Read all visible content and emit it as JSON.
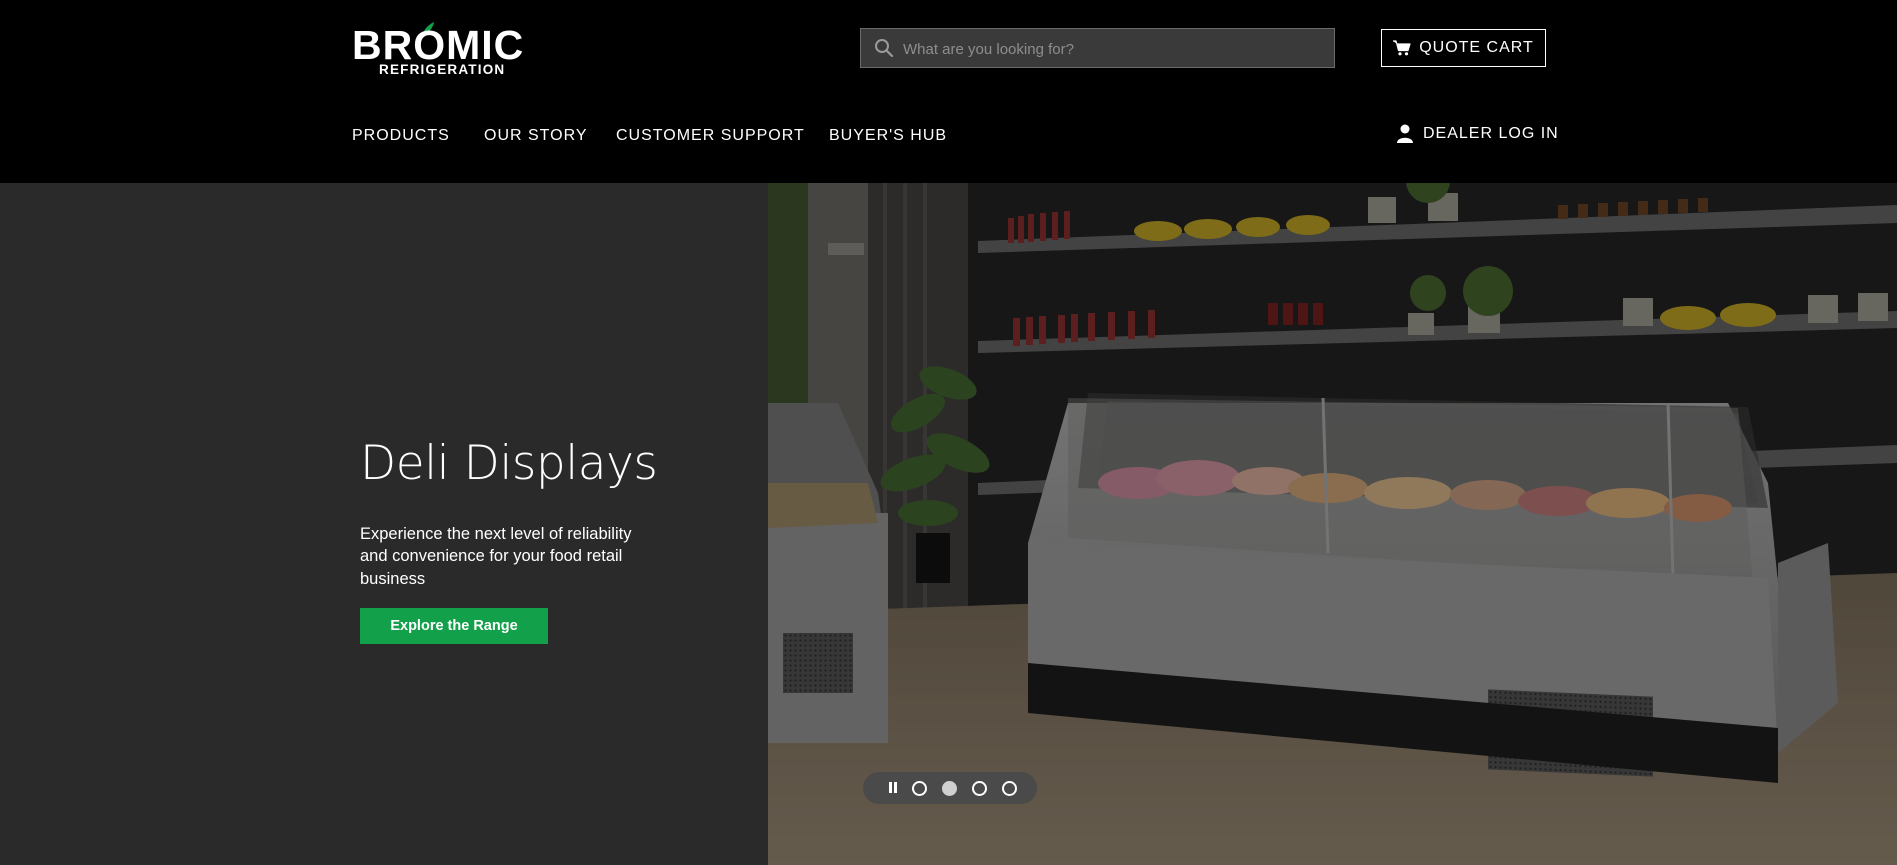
{
  "brand": {
    "name": "BROMIC",
    "sub": "REFRIGERATION",
    "accent": "#13a04a"
  },
  "search": {
    "placeholder": "What are you looking for?",
    "value": "",
    "icon": "search-icon"
  },
  "quote_cart": {
    "label": "QUOTE CART",
    "icon": "cart-icon"
  },
  "nav": [
    {
      "label": "PRODUCTS"
    },
    {
      "label": "OUR STORY"
    },
    {
      "label": "CUSTOMER SUPPORT"
    },
    {
      "label": "BUYER'S HUB"
    }
  ],
  "dealer_login": {
    "label": "DEALER LOG IN",
    "icon": "user-icon"
  },
  "hero": {
    "title": "Deli Displays",
    "text": "Experience the next level of reliability and convenience for your food retail business",
    "cta": "Explore the Range",
    "image": "deli-display-case-photo"
  },
  "slider": {
    "slides": 4,
    "active_index": 1,
    "state": "playing"
  }
}
